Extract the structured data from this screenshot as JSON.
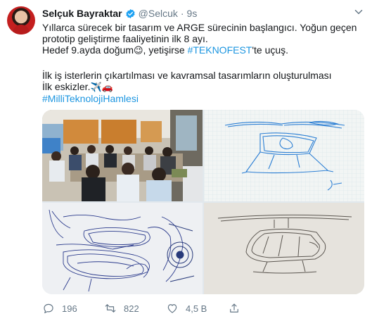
{
  "author": {
    "name": "Selçuk Bayraktar",
    "handle": "@Selcuk",
    "separator": "·",
    "time": "9s"
  },
  "tweet": {
    "line1": "Yıllarca sürecek bir tasarım ve ARGE sürecinin başlangıcı. Yoğun geçen",
    "line2": "prototip geliştirme faaliyetinin ilk 8 ayı.",
    "line3_prefix": "Hedef 9.ayda doğum",
    "line3_emoji": "😉",
    "line3_middle": ", yetişirse ",
    "line3_hashtag": "#TEKNOFEST",
    "line3_suffix": "'te uçuş.",
    "line4": "İlk iş isterlerin çıkartılması ve kavramsal tasarımların oluşturulması",
    "line5_prefix": "İlk eskizler.",
    "line5_emoji": "✈️🚗",
    "line6_hashtag": "#MilliTeknolojiHamlesi"
  },
  "actions": {
    "reply_count": "196",
    "retweet_count": "822",
    "like_count": "4,5 B"
  },
  "colors": {
    "hashtag": "#1b95e0",
    "verified": "#1da1f2",
    "meta": "#657786"
  },
  "icons": [
    "verified-badge-icon",
    "more-chevron-icon",
    "reply-icon",
    "retweet-icon",
    "like-icon",
    "share-icon"
  ]
}
